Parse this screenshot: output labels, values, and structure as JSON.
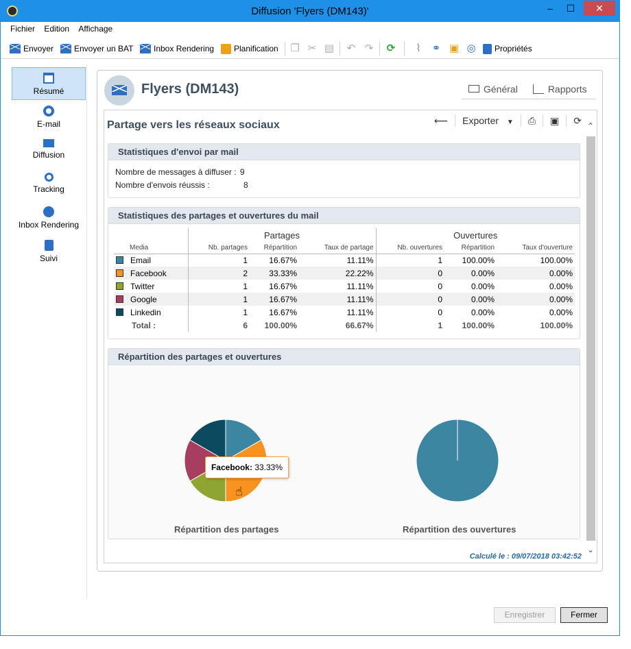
{
  "window": {
    "title": "Diffusion 'Flyers (DM143)'",
    "controls": [
      "–",
      "☐",
      "✕"
    ]
  },
  "menu": [
    "Fichier",
    "Edition",
    "Affichage"
  ],
  "toolbar": {
    "send": "Envoyer",
    "send_proof": "Envoyer un BAT",
    "inbox_rendering": "Inbox Rendering",
    "planning": "Planification",
    "properties": "Propriétés"
  },
  "sidebar": {
    "items": [
      {
        "label": "Résumé",
        "icon": "summary-icon",
        "active": true
      },
      {
        "label": "E-mail",
        "icon": "email-icon"
      },
      {
        "label": "Diffusion",
        "icon": "delivery-icon"
      },
      {
        "label": "Tracking",
        "icon": "tracking-icon"
      },
      {
        "label": "Inbox Rendering",
        "icon": "globe-icon"
      },
      {
        "label": "Suivi",
        "icon": "monitoring-icon"
      }
    ]
  },
  "header": {
    "title": "Flyers (DM143)",
    "tabs": {
      "general": "Général",
      "reports": "Rapports"
    }
  },
  "report": {
    "title": "Partage vers les réseaux sociaux",
    "export": "Exporter",
    "mail_stats": {
      "heading": "Statistiques d'envoi par mail",
      "line1_label": "Nombre de messages à diffuser :",
      "line1_value": "9",
      "line2_label": "Nombre d'envois réussis :",
      "line2_value": "8"
    },
    "share_stats": {
      "heading": "Statistiques des partages et ouvertures du mail",
      "group_shares": "Partages",
      "group_opens": "Ouvertures",
      "columns": [
        "Media",
        "Nb. partages",
        "Répartition",
        "Taux de partage",
        "Nb. ouvertures",
        "Répartition",
        "Taux d'ouverture"
      ],
      "rows": [
        {
          "media": "Email",
          "color": "#3d86a1",
          "shares": "1",
          "share_pct": "16.67%",
          "share_rate": "11.11%",
          "opens": "1",
          "open_pct": "100.00%",
          "open_rate": "100.00%"
        },
        {
          "media": "Facebook",
          "color": "#f7931e",
          "shares": "2",
          "share_pct": "33.33%",
          "share_rate": "22.22%",
          "opens": "0",
          "open_pct": "0.00%",
          "open_rate": "0.00%"
        },
        {
          "media": "Twitter",
          "color": "#8fa431",
          "shares": "1",
          "share_pct": "16.67%",
          "share_rate": "11.11%",
          "opens": "0",
          "open_pct": "0.00%",
          "open_rate": "0.00%"
        },
        {
          "media": "Google",
          "color": "#a83e5f",
          "shares": "1",
          "share_pct": "16.67%",
          "share_rate": "11.11%",
          "opens": "0",
          "open_pct": "0.00%",
          "open_rate": "0.00%"
        },
        {
          "media": "Linkedin",
          "color": "#0c4a60",
          "shares": "1",
          "share_pct": "16.67%",
          "share_rate": "11.11%",
          "opens": "0",
          "open_pct": "0.00%",
          "open_rate": "0.00%"
        }
      ],
      "total": {
        "label": "Total :",
        "shares": "6",
        "share_pct": "100.00%",
        "share_rate": "66.67%",
        "opens": "1",
        "open_pct": "100.00%",
        "open_rate": "100.00%"
      }
    },
    "charts_panel": {
      "heading": "Répartition des partages et ouvertures",
      "tooltip_label": "Facebook:",
      "tooltip_value": "33.33%"
    },
    "calc": "Calculé le : 09/07/2018 03:42:52"
  },
  "chart_data": [
    {
      "type": "pie",
      "title": "Répartition des partages",
      "categories": [
        "Email",
        "Facebook",
        "Twitter",
        "Google",
        "Linkedin"
      ],
      "values": [
        16.67,
        33.33,
        16.67,
        16.67,
        16.67
      ],
      "colors": [
        "#3d86a1",
        "#f7931e",
        "#8fa431",
        "#a83e5f",
        "#0c4a60"
      ]
    },
    {
      "type": "pie",
      "title": "Répartition des ouvertures",
      "categories": [
        "Email",
        "Facebook",
        "Twitter",
        "Google",
        "Linkedin"
      ],
      "values": [
        100,
        0,
        0,
        0,
        0
      ],
      "colors": [
        "#3d86a1",
        "#f7931e",
        "#8fa431",
        "#a83e5f",
        "#0c4a60"
      ]
    }
  ],
  "buttons": {
    "save": "Enregistrer",
    "close": "Fermer"
  }
}
